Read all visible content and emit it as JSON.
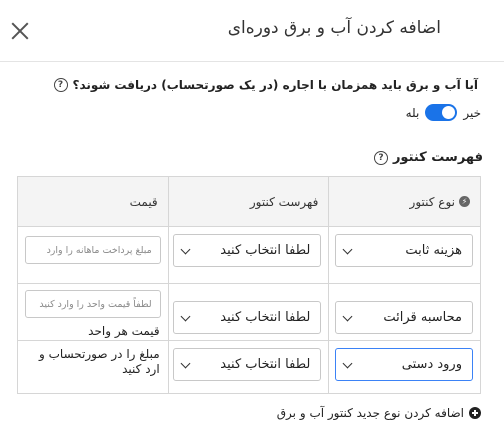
{
  "dialog": {
    "title": "اضافه کردن آب و برق دوره‌ای"
  },
  "question": {
    "text": "آیا آب و برق باید همزمان با اجاره (در یک صورتحساب) دریافت شوند؟",
    "help_glyph": "?"
  },
  "toggle": {
    "yes_label": "بله",
    "no_label": "خیر",
    "state": "on",
    "accent": "#1a73e8"
  },
  "meters": {
    "title": "فهرست کنتور",
    "help_glyph": "?",
    "headers": {
      "type": "نوع کنتور",
      "list": "فهرست کنتور",
      "price": "قیمت"
    },
    "rows": [
      {
        "type": "هزینه ثابت",
        "list": "لطفا انتخاب کنید",
        "price_placeholder": "مبلغ پرداخت ماهانه را وارد",
        "price_label": ""
      },
      {
        "type": "محاسبه قرائت",
        "list": "لطفا انتخاب کنید",
        "price_placeholder": "لطفاً قیمت واحد را وارد کنید",
        "price_label": "قیمت هر واحد"
      },
      {
        "type": "ورود دستی",
        "list": "لطفا انتخاب کنید",
        "price_placeholder": "",
        "price_label": "مبلغ را در صورتحساب و\nارد کنید"
      }
    ]
  },
  "add_link": {
    "label": "اضافه کردن نوع جدید کنتور آب و برق"
  }
}
